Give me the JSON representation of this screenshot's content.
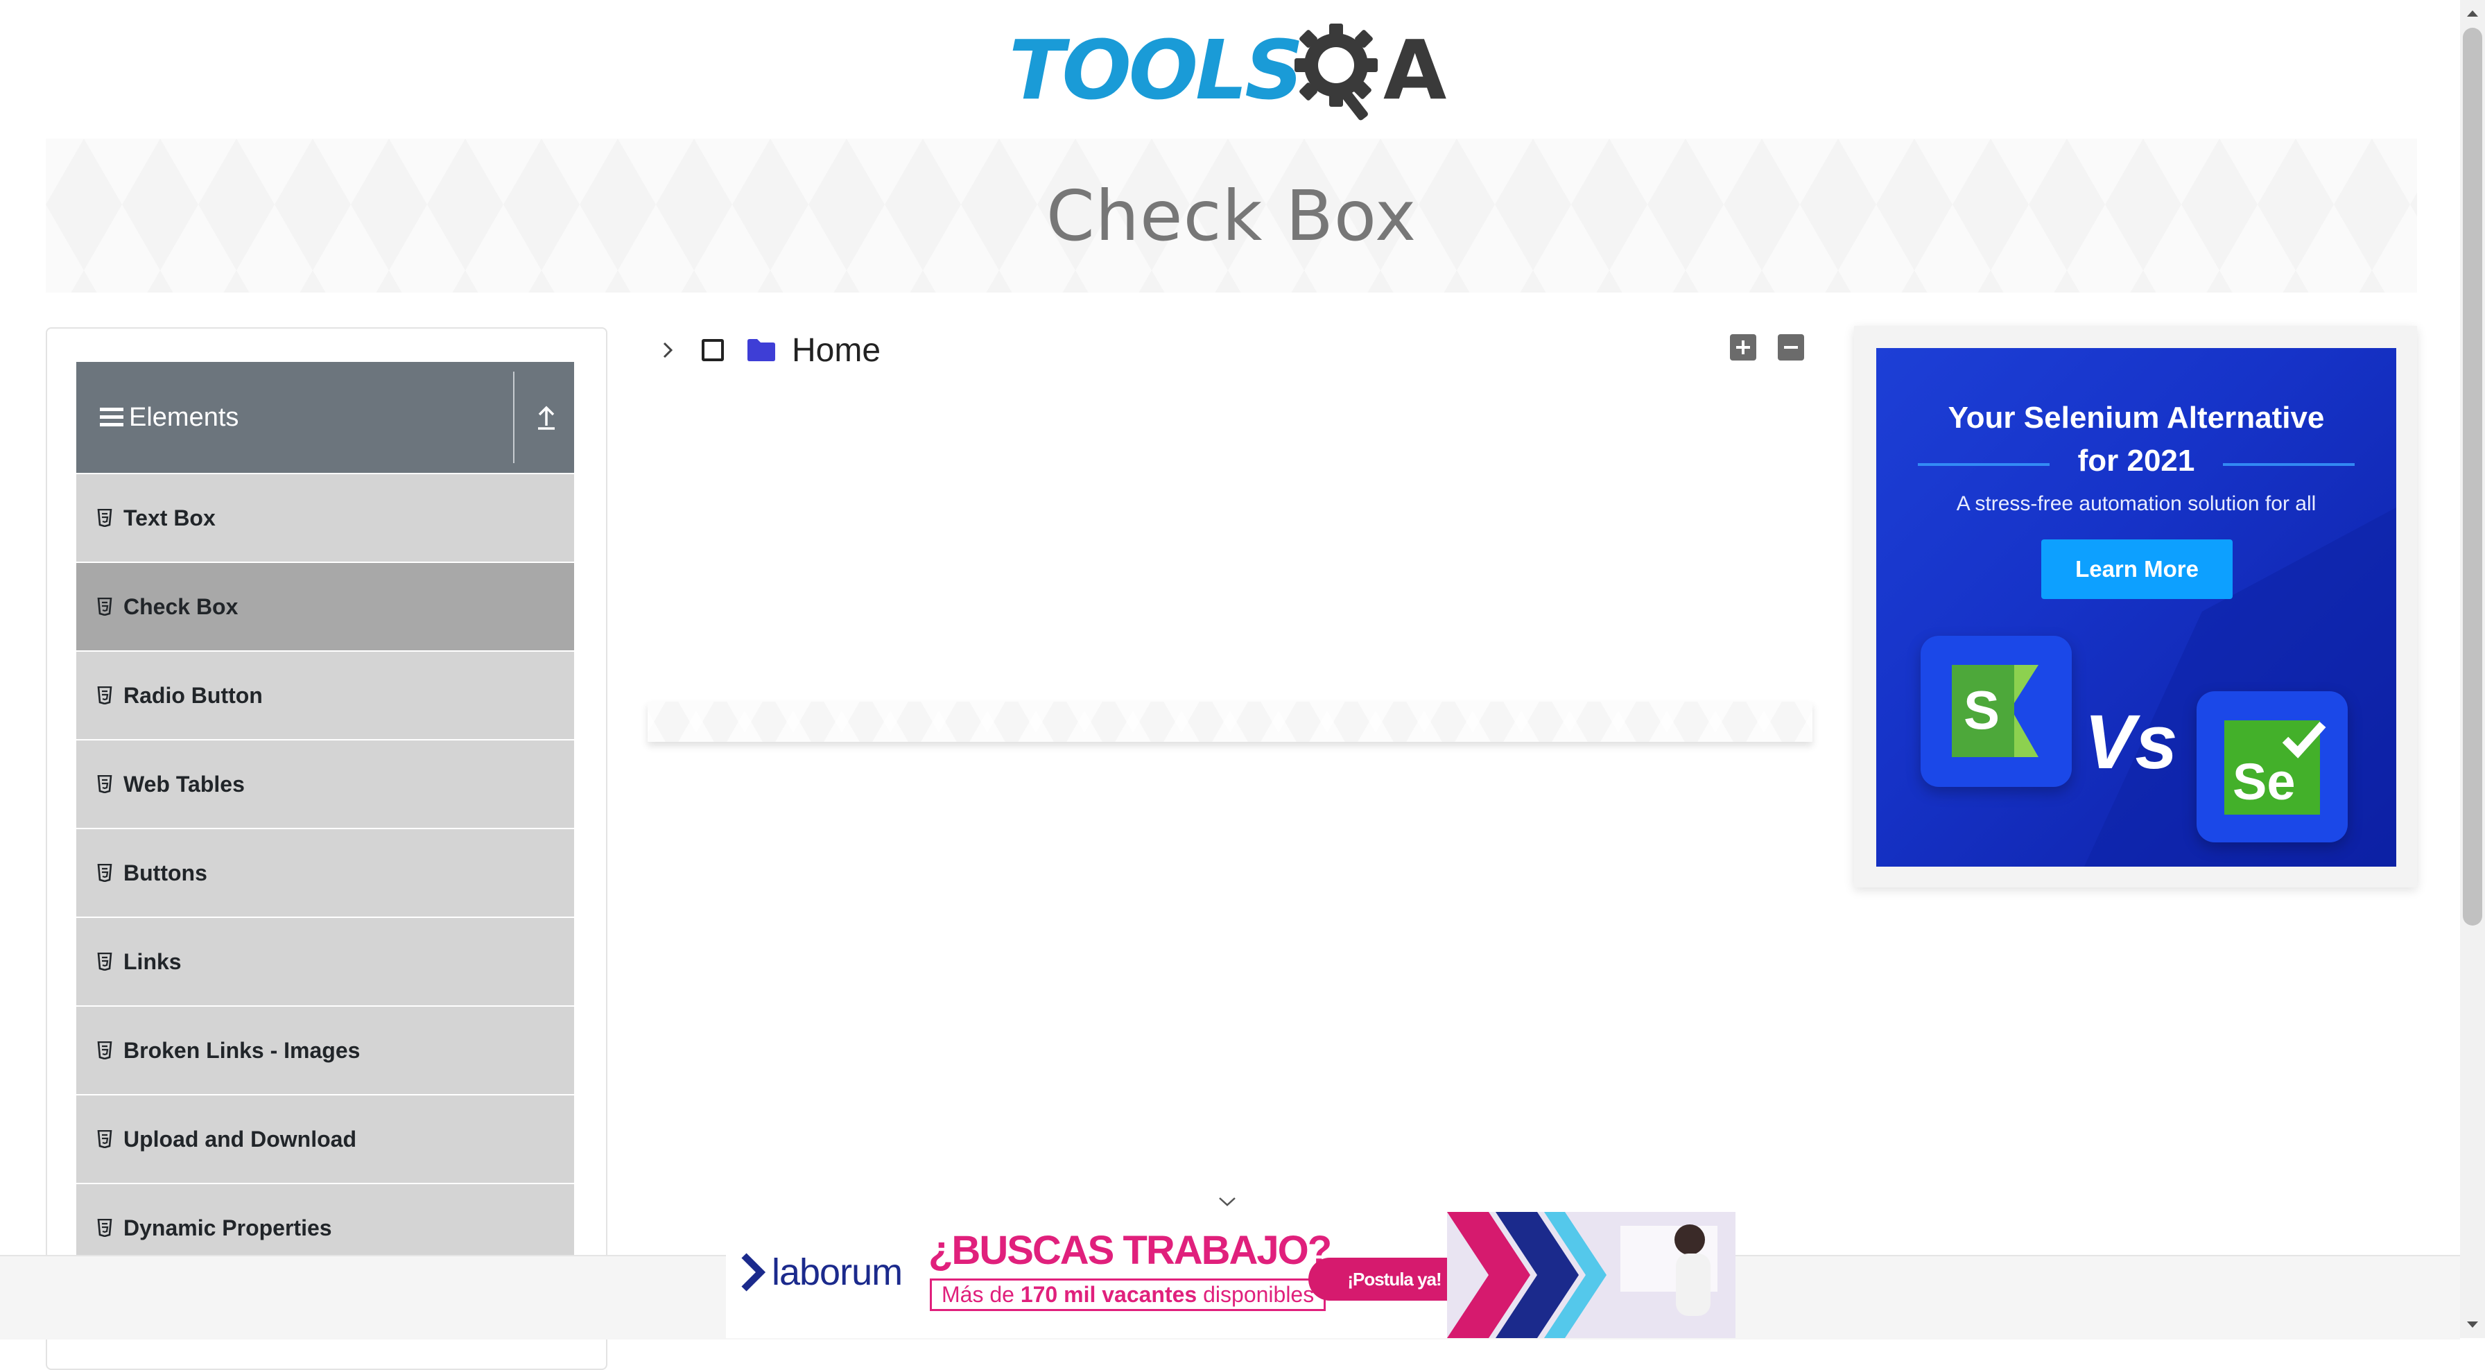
{
  "header": {
    "logo_text": "TOOLS",
    "logo_suffix": "A",
    "page_title": "Check Box"
  },
  "sidebar": {
    "group_title": "Elements",
    "items": [
      {
        "label": "Text Box",
        "active": false
      },
      {
        "label": "Check Box",
        "active": true
      },
      {
        "label": "Radio Button",
        "active": false
      },
      {
        "label": "Web Tables",
        "active": false
      },
      {
        "label": "Buttons",
        "active": false
      },
      {
        "label": "Links",
        "active": false
      },
      {
        "label": "Broken Links - Images",
        "active": false
      },
      {
        "label": "Upload and Download",
        "active": false
      },
      {
        "label": "Dynamic Properties",
        "active": false
      }
    ]
  },
  "tree": {
    "root_label": "Home",
    "expanded": false,
    "checked": false
  },
  "right_ad": {
    "title_line1": "Your Selenium Alternative",
    "title_line2": "for 2021",
    "subtitle": "A stress-free automation solution for all",
    "button_label": "Learn More",
    "vs_text": "Vs",
    "left_logo_letter": "S",
    "right_logo_text": "Se"
  },
  "bottom_ad": {
    "brand": "laborum",
    "headline": "¿BUSCAS TRABAJO?",
    "sub_prefix": "Más de ",
    "sub_bold": "170 mil vacantes",
    "sub_suffix": " disponibles",
    "cta": "¡Postula ya!"
  },
  "colors": {
    "logo_blue": "#1a9bd7",
    "sidebar_header": "#6c757d",
    "menu_item": "#d4d4d4",
    "menu_item_active": "#a8a8a8",
    "folder": "#3e3ed6",
    "ad_blue": "#1633c8",
    "ad_button": "#0da0ff",
    "laborum_pink": "#e0207c"
  }
}
